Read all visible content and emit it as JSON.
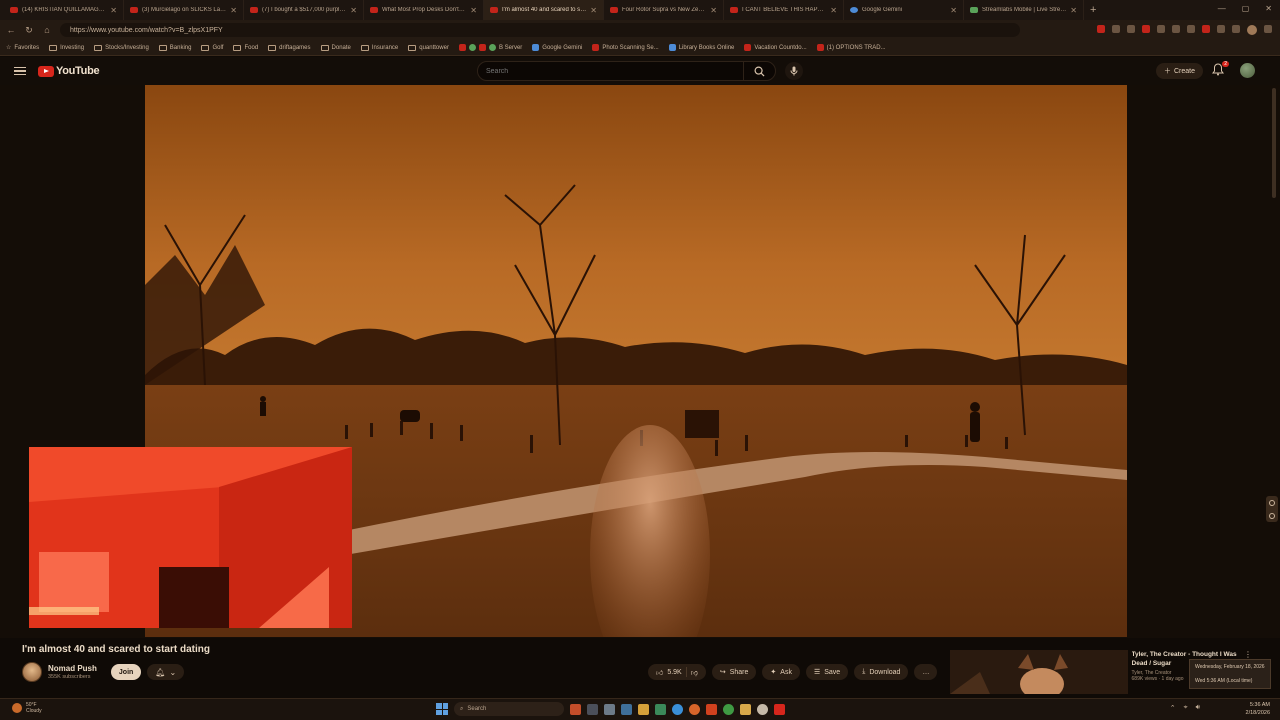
{
  "browser": {
    "tabs": [
      {
        "title": "(14) KRISTIAN QUILLAMAGGIE - M",
        "fav": "youtube"
      },
      {
        "title": "(3) Murcielago on SLICKS Laps the",
        "fav": "youtube"
      },
      {
        "title": "(7) I bought a $517,000 purple Fe",
        "fav": "youtube"
      },
      {
        "title": "What Most Prop Desks Don't Wa",
        "fav": "youtube"
      },
      {
        "title": "I'm almost 40 and scared to start",
        "fav": "youtube"
      },
      {
        "title": "Four Rotor Supra vs New Zealand",
        "fav": "youtube"
      },
      {
        "title": "I CANT BELIEVE THIS HAPPENED",
        "fav": "youtube"
      },
      {
        "title": "Google Gemini",
        "fav": "gemini"
      },
      {
        "title": "Streamlabs Mobile | Live Streamin",
        "fav": "streamlabs"
      }
    ],
    "active_tab": 4,
    "new_tab": "+",
    "url": "https://www.youtube.com/watch?v=B_zlpsX1PFY",
    "bookmarks": [
      {
        "label": "Favorites",
        "kind": "star"
      },
      {
        "label": "Investing",
        "kind": "folder"
      },
      {
        "label": "Stocks/Investing",
        "kind": "folder"
      },
      {
        "label": "Banking",
        "kind": "folder"
      },
      {
        "label": "Golf",
        "kind": "folder"
      },
      {
        "label": "Food",
        "kind": "folder"
      },
      {
        "label": "driftagames",
        "kind": "folder"
      },
      {
        "label": "Donate",
        "kind": "folder"
      },
      {
        "label": "Insurance",
        "kind": "folder"
      },
      {
        "label": "quanttower",
        "kind": "folder"
      },
      {
        "label": "B Server",
        "kind": "icon"
      },
      {
        "label": "Google Gemini",
        "kind": "icon"
      },
      {
        "label": "Photo Scanning Se...",
        "kind": "icon"
      },
      {
        "label": "Library Books Online",
        "kind": "icon"
      },
      {
        "label": "Vacation Countdo...",
        "kind": "icon"
      },
      {
        "label": "(1) OPTIONS TRAD...",
        "kind": "icon"
      }
    ]
  },
  "youtube": {
    "logo_text": "YouTube",
    "search_placeholder": "Search",
    "create_label": "Create",
    "notification_count": "2",
    "video_title": "I'm almost 40 and scared to start dating",
    "channel": {
      "name": "Nomad Push",
      "subscribers": "355K subscribers"
    },
    "join_label": "Join",
    "actions": {
      "likes": "5.9K",
      "share": "Share",
      "ask": "Ask",
      "save": "Save",
      "download": "Download",
      "more": "…"
    },
    "up_next": {
      "title": "Tyler, The Creator - Thought I Was Dead / Sugar",
      "channel": "Tyler, The Creator",
      "meta": "689K views · 1 day ago"
    }
  },
  "tooltip": {
    "date": "Wednesday, February 18, 2026",
    "time": "Wed 5:36 AM (Local time)"
  },
  "taskbar": {
    "weather_temp": "50°F",
    "weather_desc": "Cloudy",
    "search_label": "Search",
    "clock_time": "5:36 AM",
    "clock_date": "2/18/2026"
  },
  "colors": {
    "accent_red": "#d7261c",
    "tint": "#a35416"
  }
}
